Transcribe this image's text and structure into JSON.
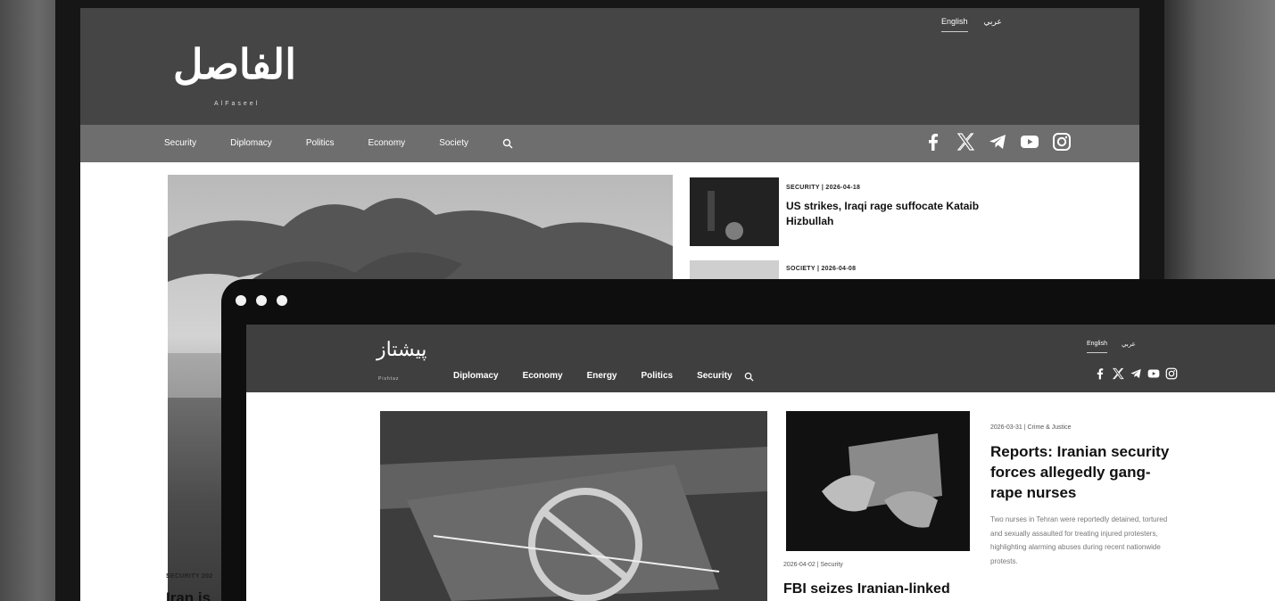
{
  "back": {
    "logo_arabic": "الفاصل",
    "logo_latin": "AlFaseel",
    "lang_english": "English",
    "lang_arabic": "عربي",
    "nav": [
      "Security",
      "Diplomacy",
      "Politics",
      "Economy",
      "Society"
    ],
    "social": [
      "facebook-icon",
      "x-icon",
      "telegram-icon",
      "youtube-icon",
      "instagram-icon"
    ],
    "articles": [
      {
        "meta": "SECURITY | 2026-04-18",
        "title_line1": "US strikes, Iraqi rage suffocate Kataib",
        "title_line2": "Hizbullah"
      },
      {
        "meta": "SOCIETY | 2026-04-08"
      }
    ],
    "hero_tag": "SECURITY 202",
    "hero_title": "Iran is"
  },
  "front": {
    "logo_arabic": "پیشتاز",
    "logo_latin": "Pishtaz",
    "lang_english": "English",
    "lang_arabic": "عربي",
    "nav": [
      "Diplomacy",
      "Economy",
      "Energy",
      "Politics",
      "Security"
    ],
    "social": [
      "facebook-icon",
      "x-icon",
      "telegram-icon",
      "youtube-icon",
      "instagram-icon"
    ],
    "article_small": {
      "meta": "2026-04-02 | Security",
      "title": "FBI seizes Iranian-linked"
    },
    "article_large": {
      "meta": "2026-03-31 | Crime & Justice",
      "title": "Reports: Iranian security forces allegedly gang-rape nurses",
      "excerpt": "Two nurses in Tehran were reportedly detained, tortured and sexually assaulted for treating injured protesters, highlighting alarming abuses during recent nationwide protests."
    }
  }
}
